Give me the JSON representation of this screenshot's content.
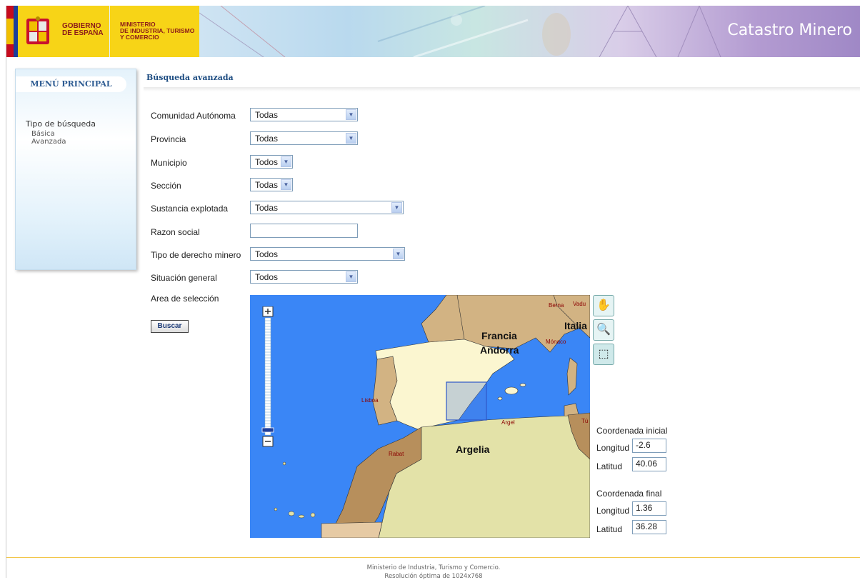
{
  "header": {
    "gov_line1": "GOBIERNO",
    "gov_line2": "DE ESPAÑA",
    "ministry_line1": "MINISTERIO",
    "ministry_line2": "DE INDUSTRIA, TURISMO",
    "ministry_line3": "Y COMERCIO",
    "app_title": "Catastro Minero"
  },
  "sidebar": {
    "title": "MENÚ PRINCIPAL",
    "section": "Tipo de búsqueda",
    "items": [
      {
        "label": "Básica"
      },
      {
        "label": "Avanzada"
      }
    ]
  },
  "main": {
    "title": "Búsqueda avanzada",
    "fields": [
      {
        "label": "Comunidad Autónoma",
        "value": "Todas"
      },
      {
        "label": "Provincia",
        "value": "Todas"
      },
      {
        "label": "Municipio",
        "value": "Todos"
      },
      {
        "label": "Sección",
        "value": "Todas"
      },
      {
        "label": "Sustancia explotada",
        "value": "Todas"
      },
      {
        "label": "Razon social",
        "value": ""
      },
      {
        "label": "Tipo de derecho minero",
        "value": "Todos"
      },
      {
        "label": "Situación general",
        "value": "Todos"
      }
    ],
    "area_label": "Area de selección",
    "search_button": "Buscar"
  },
  "map": {
    "labels": {
      "francia": "Francia",
      "andorra": "Andorra",
      "italia": "Italia",
      "argelia": "Argelia",
      "berna": "Berna",
      "vaduz": "Vadu",
      "monaco": "Mónaco",
      "lisboa": "Lisboa",
      "rabat": "Rabat",
      "argel": "Argel",
      "tunez": "Tú"
    },
    "colors": {
      "sea": "#3a86f6",
      "spain": "#fbf6d0",
      "france": "#d2b383",
      "africa": "#b78f5c",
      "algeria": "#e3e2a8"
    },
    "tools": [
      "hand-pan-icon",
      "zoom-box-icon",
      "select-box-icon"
    ]
  },
  "coords": {
    "start_title": "Coordenada inicial",
    "start_lon_label": "Longitud",
    "start_lon": "-2.6",
    "start_lat_label": "Latitud",
    "start_lat": "40.06",
    "end_title": "Coordenada final",
    "end_lon_label": "Longitud",
    "end_lon": "1.36",
    "end_lat_label": "Latitud",
    "end_lat": "36.28"
  },
  "footer": {
    "line1": "Ministerio de Industria, Turismo y Comercio.",
    "line2": "Resolución óptima de 1024x768"
  }
}
